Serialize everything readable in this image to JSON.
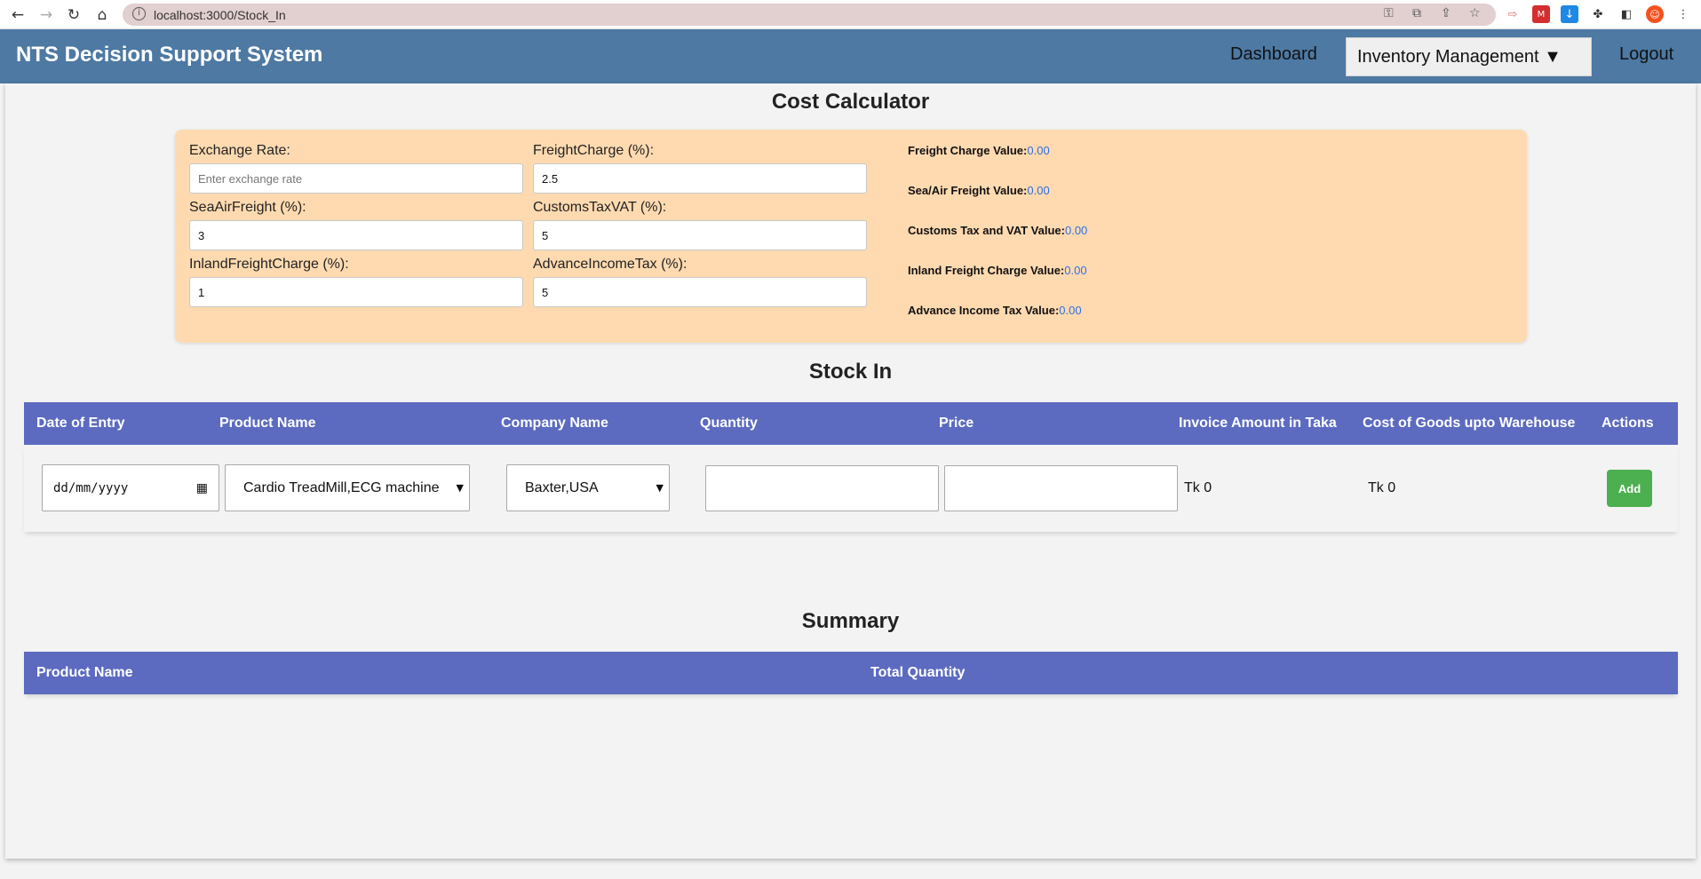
{
  "browser": {
    "url": "localhost:3000/Stock_In"
  },
  "header": {
    "title": "NTS Decision Support System",
    "nav": {
      "dashboard": "Dashboard",
      "inventory": "Inventory Management ▼",
      "logout": "Logout"
    },
    "colors": {
      "background": "#4d79a3"
    }
  },
  "cost_calculator": {
    "title": "Cost Calculator",
    "fields": {
      "exchange_rate": {
        "label": "Exchange Rate:",
        "value": "",
        "placeholder": "Enter exchange rate"
      },
      "freight_charge": {
        "label": "FreightCharge (%):",
        "value": "2.5"
      },
      "sea_air_freight": {
        "label": "SeaAirFreight (%):",
        "value": "3"
      },
      "customs_tax_vat": {
        "label": "CustomsTaxVAT (%):",
        "value": "5"
      },
      "inland_freight_charge": {
        "label": "InlandFreightCharge (%):",
        "value": "1"
      },
      "advance_income_tax": {
        "label": "AdvanceIncomeTax (%):",
        "value": "5"
      }
    },
    "results": {
      "freight_charge": {
        "label": "Freight Charge Value:",
        "value": "0.00"
      },
      "sea_air_freight": {
        "label": "Sea/Air Freight Value:",
        "value": "0.00"
      },
      "customs_tax_vat": {
        "label": "Customs Tax and VAT Value:",
        "value": "0.00"
      },
      "inland_freight": {
        "label": "Inland Freight Charge Value:",
        "value": "0.00"
      },
      "advance_income_tax": {
        "label": "Advance Income Tax Value:",
        "value": "0.00"
      }
    },
    "colors": {
      "card": "#ffdab0",
      "result_value": "#2f6fe4"
    }
  },
  "stock_in": {
    "title": "Stock In",
    "columns": [
      "Date of Entry",
      "Product Name",
      "Company Name",
      "Quantity",
      "Price",
      "Invoice Amount in Taka",
      "Cost of Goods upto Warehouse",
      "Actions"
    ],
    "row": {
      "date_placeholder": "dd/mm/yyyy",
      "product": "Cardio TreadMill,ECG machine",
      "company": "Baxter,USA",
      "quantity": "",
      "price": "",
      "invoice_amount": "Tk 0",
      "cost_of_goods": "Tk 0",
      "add_label": "Add"
    },
    "colors": {
      "header": "#5c6bc0",
      "add_button": "#4caf50"
    }
  },
  "summary": {
    "title": "Summary",
    "columns": [
      "Product Name",
      "Total Quantity"
    ]
  }
}
